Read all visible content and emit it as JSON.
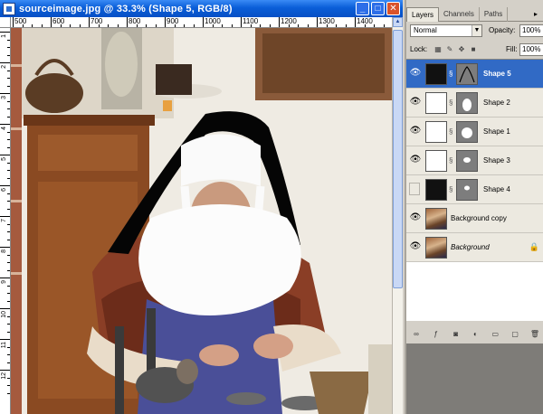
{
  "document": {
    "title": "sourceimage.jpg @ 33.3% (Shape 5, RGB/8)",
    "window_buttons": {
      "minimize": "_",
      "maximize": "□",
      "close": "✕"
    },
    "ruler_top_labels": [
      "500",
      "600",
      "700",
      "800",
      "900",
      "1000",
      "1100",
      "1200",
      "1300",
      "1400"
    ],
    "ruler_left_labels": [
      "1",
      "2",
      "3",
      "4",
      "5",
      "6",
      "7",
      "8",
      "9",
      "10",
      "11",
      "12"
    ]
  },
  "palette": {
    "tabs": [
      "Layers",
      "Channels",
      "Paths"
    ],
    "menu_icon": "palette-menu-icon",
    "blend_mode": "Normal",
    "opacity_label": "Opacity:",
    "opacity_value": "100%",
    "lock_label": "Lock:",
    "fill_label": "Fill:",
    "fill_value": "100%",
    "layers": [
      {
        "name": "Shape 5",
        "thumb": "black",
        "mask": "shape5",
        "visible": true,
        "selected": true,
        "italic": false,
        "locked": false
      },
      {
        "name": "Shape 2",
        "thumb": "white",
        "mask": "shape2",
        "visible": true,
        "selected": false,
        "italic": false,
        "locked": false
      },
      {
        "name": "Shape 1",
        "thumb": "white",
        "mask": "shape1",
        "visible": true,
        "selected": false,
        "italic": false,
        "locked": false
      },
      {
        "name": "Shape 3",
        "thumb": "white",
        "mask": "shape3",
        "visible": true,
        "selected": false,
        "italic": false,
        "locked": false
      },
      {
        "name": "Shape 4",
        "thumb": "black",
        "mask": "shape4",
        "visible": false,
        "selected": false,
        "italic": false,
        "locked": false
      },
      {
        "name": "Background copy",
        "thumb": "photo",
        "mask": null,
        "visible": true,
        "selected": false,
        "italic": false,
        "locked": false
      },
      {
        "name": "Background",
        "thumb": "photo",
        "mask": null,
        "visible": true,
        "selected": false,
        "italic": true,
        "locked": true
      }
    ],
    "bottom_icons": [
      "link-layers-icon",
      "layer-style-icon",
      "add-mask-icon",
      "adjustment-layer-icon",
      "new-group-icon",
      "new-layer-icon",
      "delete-layer-icon"
    ]
  }
}
